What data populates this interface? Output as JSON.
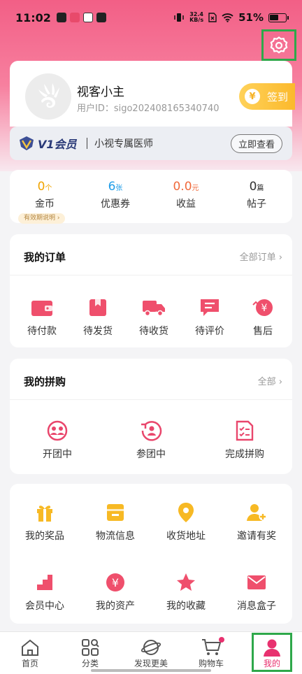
{
  "status_bar": {
    "time": "11:02",
    "net_speed_value": "32.4",
    "net_speed_unit": "KB/s",
    "battery": "51%"
  },
  "profile": {
    "nickname": "视客小主",
    "user_id": "用户ID：sigo202408165340740",
    "signin_label": "签到",
    "signin_icon": "¥"
  },
  "vip": {
    "logo_text": "V1会员",
    "desc": "小视专属医师",
    "button": "立即查看"
  },
  "stats": [
    {
      "value": "0",
      "unit": "个",
      "label": "金币",
      "color": "#f0a400"
    },
    {
      "value": "6",
      "unit": "张",
      "label": "优惠券",
      "color": "#1f9de8"
    },
    {
      "value": "0.0",
      "unit": "元",
      "label": "收益",
      "color": "#f06a3c"
    },
    {
      "value": "0",
      "unit": "篇",
      "label": "帖子",
      "color": "#333333"
    }
  ],
  "coins_tag": "有效期说明 ›",
  "orders": {
    "title": "我的订单",
    "more": "全部订单",
    "items": [
      {
        "label": "待付款",
        "icon": "wallet-icon"
      },
      {
        "label": "待发货",
        "icon": "package-icon"
      },
      {
        "label": "待收货",
        "icon": "truck-icon"
      },
      {
        "label": "待评价",
        "icon": "comment-icon"
      },
      {
        "label": "售后",
        "icon": "refund-icon"
      }
    ]
  },
  "group_buy": {
    "title": "我的拼购",
    "more": "全部",
    "items": [
      {
        "label": "开团中",
        "icon": "group-icon"
      },
      {
        "label": "参团中",
        "icon": "join-icon"
      },
      {
        "label": "完成拼购",
        "icon": "checklist-icon"
      }
    ]
  },
  "tools": [
    {
      "label": "我的奖品",
      "icon": "gift-icon"
    },
    {
      "label": "物流信息",
      "icon": "box-icon"
    },
    {
      "label": "收货地址",
      "icon": "location-icon"
    },
    {
      "label": "邀请有奖",
      "icon": "invite-icon"
    },
    {
      "label": "会员中心",
      "icon": "stairs-icon"
    },
    {
      "label": "我的资产",
      "icon": "assets-icon"
    },
    {
      "label": "我的收藏",
      "icon": "star-icon"
    },
    {
      "label": "消息盒子",
      "icon": "mail-icon"
    }
  ],
  "tabbar": [
    {
      "label": "首页",
      "icon": "home-icon"
    },
    {
      "label": "分类",
      "icon": "category-icon"
    },
    {
      "label": "发现更美",
      "icon": "planet-icon"
    },
    {
      "label": "购物车",
      "icon": "cart-icon"
    },
    {
      "label": "我的",
      "icon": "user-icon"
    }
  ],
  "colors": {
    "brand_pink": "#e8316f",
    "accent_red": "#ef4f6c",
    "gold": "#f6b225",
    "highlight_green": "#2ea84a"
  }
}
